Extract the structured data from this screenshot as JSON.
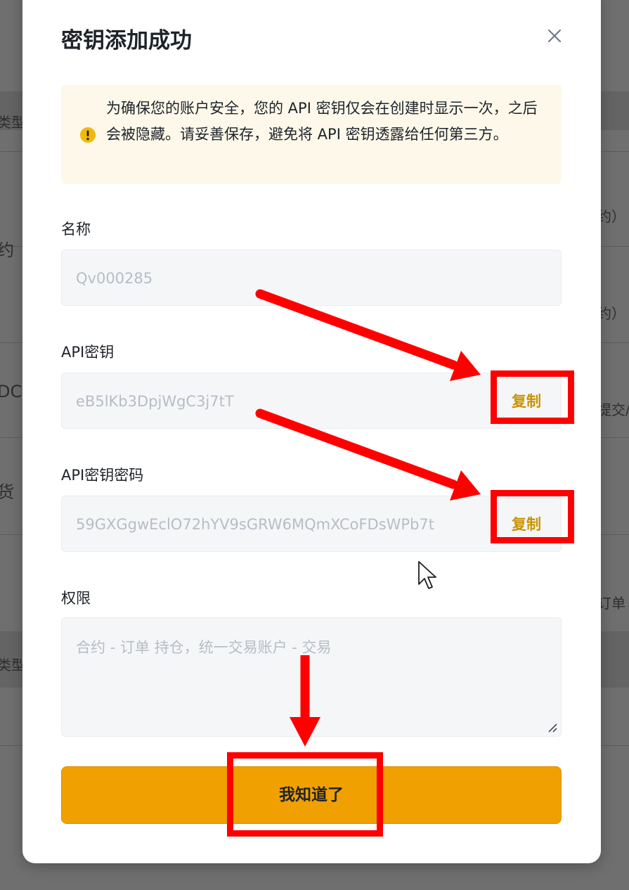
{
  "background": {
    "texts": [
      "类型",
      "约）",
      "约",
      "约）",
      "DC -",
      "提交/",
      "货",
      "订单",
      "类型"
    ]
  },
  "modal": {
    "title": "密钥添加成功",
    "notice": "为确保您的账户安全，您的 API 密钥仅会在创建时显示一次，之后会被隐藏。请妥善保存，避免将 API 密钥透露给任何第三方。",
    "name_label": "名称",
    "name_value": "Qv000285",
    "api_key_label": "API密钥",
    "api_key_value": "eB5lKb3DpjWgC3j7tT",
    "api_secret_label": "API密钥密码",
    "api_secret_value": "59GXGgwEclO72hYV9sGRW6MQmXCoFDsWPb7t",
    "copy_label": "复制",
    "permission_label": "权限",
    "permission_value": "合约 - 订单 持仓，统一交易账户 - 交易",
    "confirm_label": "我知道了"
  },
  "colors": {
    "accent": "#f0a000",
    "copy_text": "#c99400",
    "annotation": "#ff0000",
    "notice_bg": "#fdf8ea"
  },
  "icons": {
    "close": "close-icon",
    "notice": "warning-icon",
    "cursor": "mouse-cursor-icon"
  }
}
